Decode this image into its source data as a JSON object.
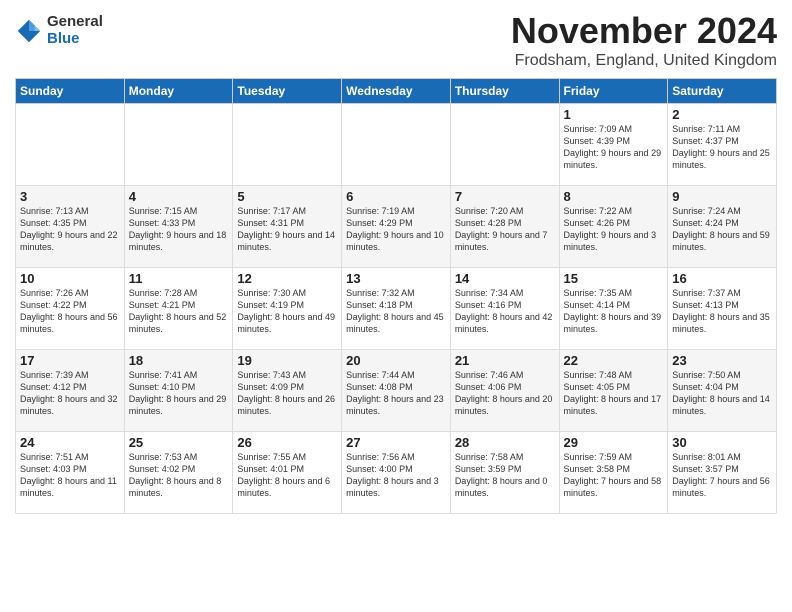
{
  "header": {
    "logo_general": "General",
    "logo_blue": "Blue",
    "title": "November 2024",
    "location": "Frodsham, England, United Kingdom"
  },
  "days_of_week": [
    "Sunday",
    "Monday",
    "Tuesday",
    "Wednesday",
    "Thursday",
    "Friday",
    "Saturday"
  ],
  "weeks": [
    [
      {
        "day": "",
        "info": ""
      },
      {
        "day": "",
        "info": ""
      },
      {
        "day": "",
        "info": ""
      },
      {
        "day": "",
        "info": ""
      },
      {
        "day": "",
        "info": ""
      },
      {
        "day": "1",
        "info": "Sunrise: 7:09 AM\nSunset: 4:39 PM\nDaylight: 9 hours and 29 minutes."
      },
      {
        "day": "2",
        "info": "Sunrise: 7:11 AM\nSunset: 4:37 PM\nDaylight: 9 hours and 25 minutes."
      }
    ],
    [
      {
        "day": "3",
        "info": "Sunrise: 7:13 AM\nSunset: 4:35 PM\nDaylight: 9 hours and 22 minutes."
      },
      {
        "day": "4",
        "info": "Sunrise: 7:15 AM\nSunset: 4:33 PM\nDaylight: 9 hours and 18 minutes."
      },
      {
        "day": "5",
        "info": "Sunrise: 7:17 AM\nSunset: 4:31 PM\nDaylight: 9 hours and 14 minutes."
      },
      {
        "day": "6",
        "info": "Sunrise: 7:19 AM\nSunset: 4:29 PM\nDaylight: 9 hours and 10 minutes."
      },
      {
        "day": "7",
        "info": "Sunrise: 7:20 AM\nSunset: 4:28 PM\nDaylight: 9 hours and 7 minutes."
      },
      {
        "day": "8",
        "info": "Sunrise: 7:22 AM\nSunset: 4:26 PM\nDaylight: 9 hours and 3 minutes."
      },
      {
        "day": "9",
        "info": "Sunrise: 7:24 AM\nSunset: 4:24 PM\nDaylight: 8 hours and 59 minutes."
      }
    ],
    [
      {
        "day": "10",
        "info": "Sunrise: 7:26 AM\nSunset: 4:22 PM\nDaylight: 8 hours and 56 minutes."
      },
      {
        "day": "11",
        "info": "Sunrise: 7:28 AM\nSunset: 4:21 PM\nDaylight: 8 hours and 52 minutes."
      },
      {
        "day": "12",
        "info": "Sunrise: 7:30 AM\nSunset: 4:19 PM\nDaylight: 8 hours and 49 minutes."
      },
      {
        "day": "13",
        "info": "Sunrise: 7:32 AM\nSunset: 4:18 PM\nDaylight: 8 hours and 45 minutes."
      },
      {
        "day": "14",
        "info": "Sunrise: 7:34 AM\nSunset: 4:16 PM\nDaylight: 8 hours and 42 minutes."
      },
      {
        "day": "15",
        "info": "Sunrise: 7:35 AM\nSunset: 4:14 PM\nDaylight: 8 hours and 39 minutes."
      },
      {
        "day": "16",
        "info": "Sunrise: 7:37 AM\nSunset: 4:13 PM\nDaylight: 8 hours and 35 minutes."
      }
    ],
    [
      {
        "day": "17",
        "info": "Sunrise: 7:39 AM\nSunset: 4:12 PM\nDaylight: 8 hours and 32 minutes."
      },
      {
        "day": "18",
        "info": "Sunrise: 7:41 AM\nSunset: 4:10 PM\nDaylight: 8 hours and 29 minutes."
      },
      {
        "day": "19",
        "info": "Sunrise: 7:43 AM\nSunset: 4:09 PM\nDaylight: 8 hours and 26 minutes."
      },
      {
        "day": "20",
        "info": "Sunrise: 7:44 AM\nSunset: 4:08 PM\nDaylight: 8 hours and 23 minutes."
      },
      {
        "day": "21",
        "info": "Sunrise: 7:46 AM\nSunset: 4:06 PM\nDaylight: 8 hours and 20 minutes."
      },
      {
        "day": "22",
        "info": "Sunrise: 7:48 AM\nSunset: 4:05 PM\nDaylight: 8 hours and 17 minutes."
      },
      {
        "day": "23",
        "info": "Sunrise: 7:50 AM\nSunset: 4:04 PM\nDaylight: 8 hours and 14 minutes."
      }
    ],
    [
      {
        "day": "24",
        "info": "Sunrise: 7:51 AM\nSunset: 4:03 PM\nDaylight: 8 hours and 11 minutes."
      },
      {
        "day": "25",
        "info": "Sunrise: 7:53 AM\nSunset: 4:02 PM\nDaylight: 8 hours and 8 minutes."
      },
      {
        "day": "26",
        "info": "Sunrise: 7:55 AM\nSunset: 4:01 PM\nDaylight: 8 hours and 6 minutes."
      },
      {
        "day": "27",
        "info": "Sunrise: 7:56 AM\nSunset: 4:00 PM\nDaylight: 8 hours and 3 minutes."
      },
      {
        "day": "28",
        "info": "Sunrise: 7:58 AM\nSunset: 3:59 PM\nDaylight: 8 hours and 0 minutes."
      },
      {
        "day": "29",
        "info": "Sunrise: 7:59 AM\nSunset: 3:58 PM\nDaylight: 7 hours and 58 minutes."
      },
      {
        "day": "30",
        "info": "Sunrise: 8:01 AM\nSunset: 3:57 PM\nDaylight: 7 hours and 56 minutes."
      }
    ]
  ]
}
